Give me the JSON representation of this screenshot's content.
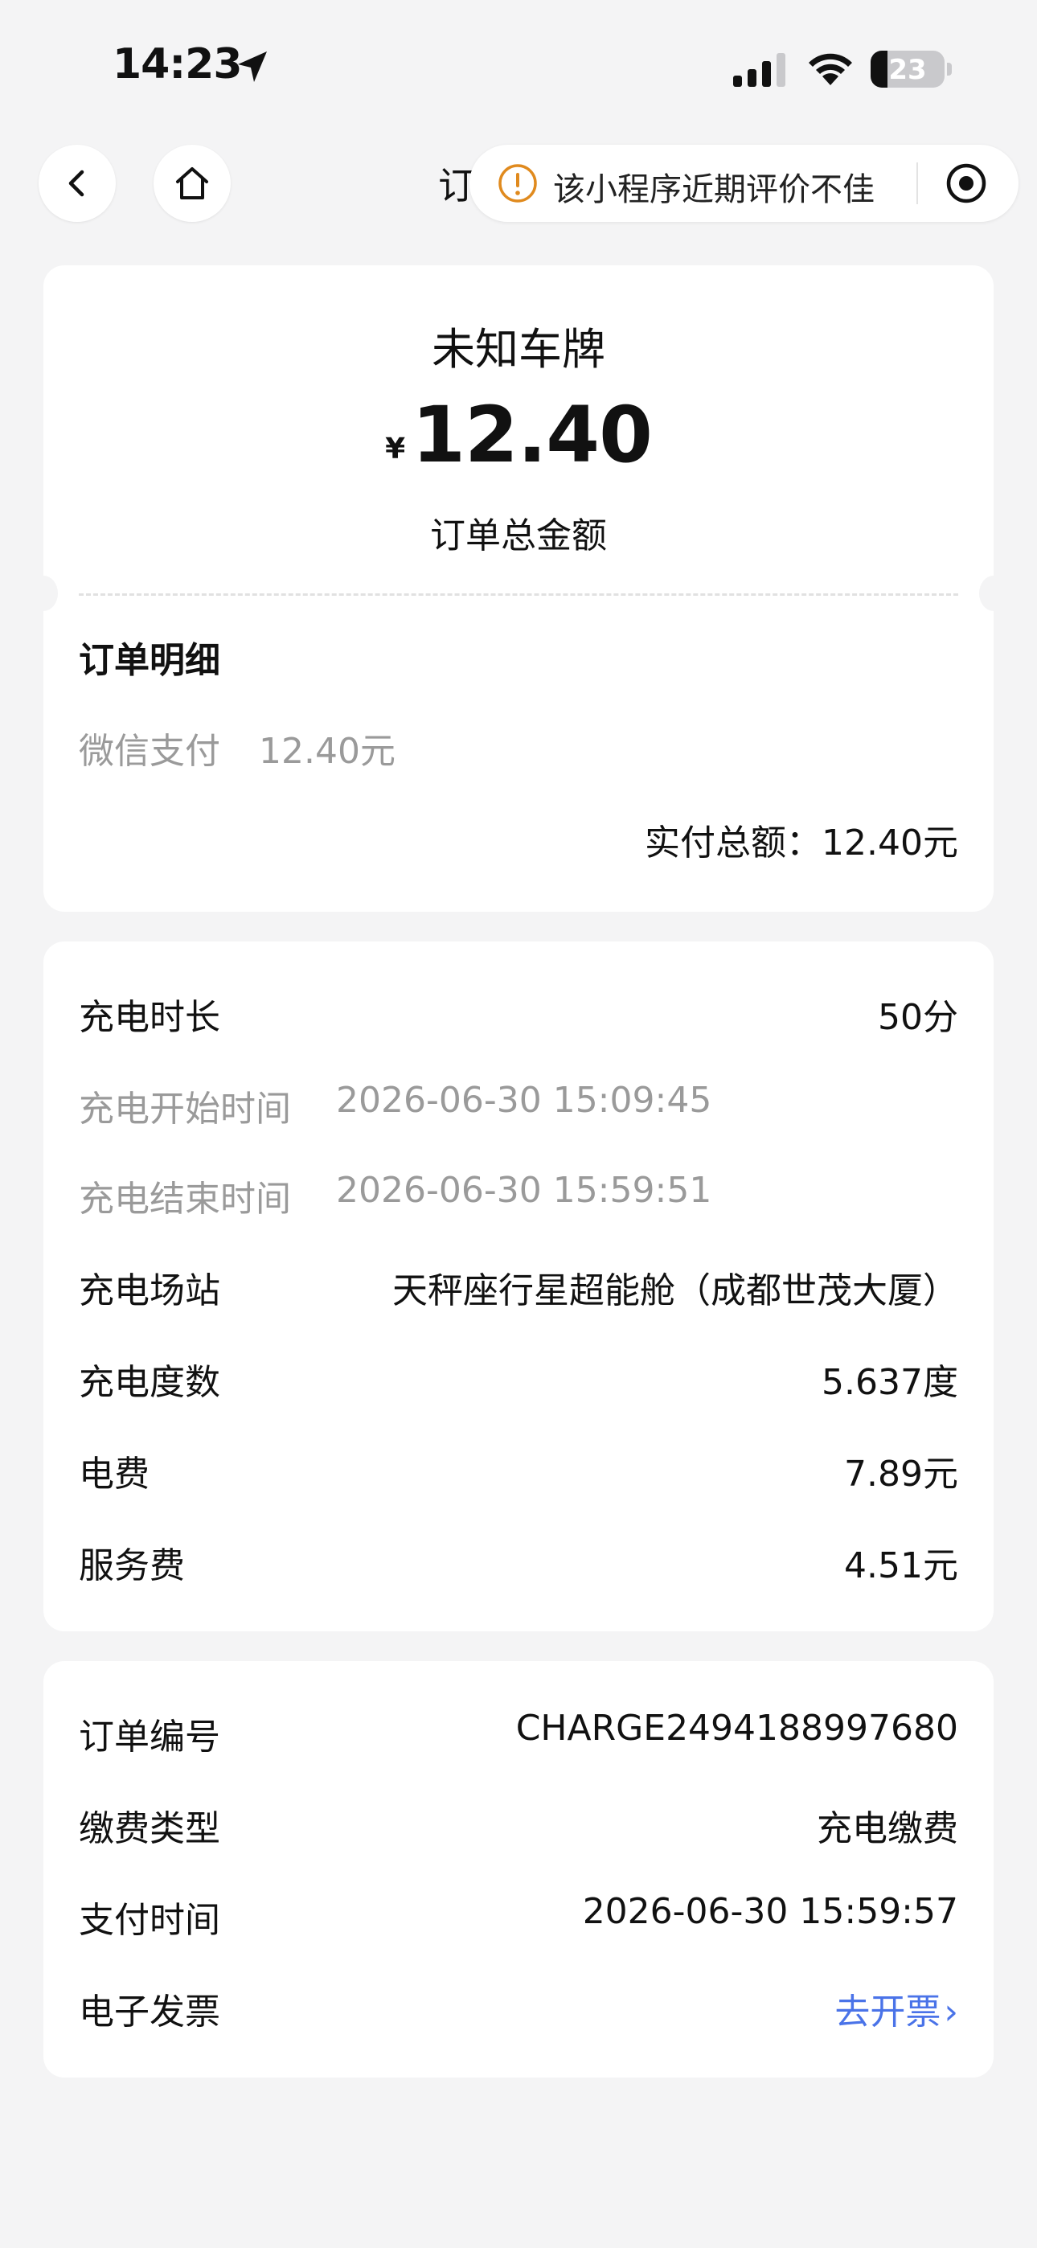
{
  "status_bar": {
    "time": "14:23",
    "battery_level": "23",
    "battery_fraction": 0.23,
    "icons": [
      "location-arrow-icon",
      "cellular-signal-icon",
      "wifi-icon",
      "battery-icon"
    ]
  },
  "nav": {
    "title_visible": "订",
    "capsule_warning": "该小程序近期评价不佳",
    "icons": [
      "back-chevron-icon",
      "home-icon",
      "info-warning-icon",
      "record-icon"
    ]
  },
  "summary": {
    "plate": "未知车牌",
    "currency_symbol": "¥",
    "amount": "12.40",
    "amount_label": "订单总金额"
  },
  "order_detail": {
    "title": "订单明细",
    "pay_method": "微信支付",
    "pay_amount": "12.40元",
    "paid_total": "实付总额：12.40元"
  },
  "charging": {
    "duration_label": "充电时长",
    "duration_value": "50分",
    "start_label": "充电开始时间",
    "start_value": "2026-06-30 15:09:45",
    "end_label": "充电结束时间",
    "end_value": "2026-06-30 15:59:51",
    "station_label": "充电场站",
    "station_value": "天秤座行星超能舱（成都世茂大厦）",
    "kwh_label": "充电度数",
    "kwh_value": "5.637度",
    "electric_fee_label": "电费",
    "electric_fee_value": "7.89元",
    "service_fee_label": "服务费",
    "service_fee_value": "4.51元"
  },
  "order_info": {
    "number_label": "订单编号",
    "number_value": "CHARGE2494188997680",
    "type_label": "缴费类型",
    "type_value": "充电缴费",
    "pay_time_label": "支付时间",
    "pay_time_value": "2026-06-30 15:59:57",
    "invoice_label": "电子发票",
    "invoice_link": "去开票",
    "invoice_chevron": "›"
  },
  "colors": {
    "background": "#f4f4f5",
    "card": "#ffffff",
    "muted_text": "#9a9a9a",
    "link": "#4a73e8",
    "warning": "#e08a1e"
  }
}
